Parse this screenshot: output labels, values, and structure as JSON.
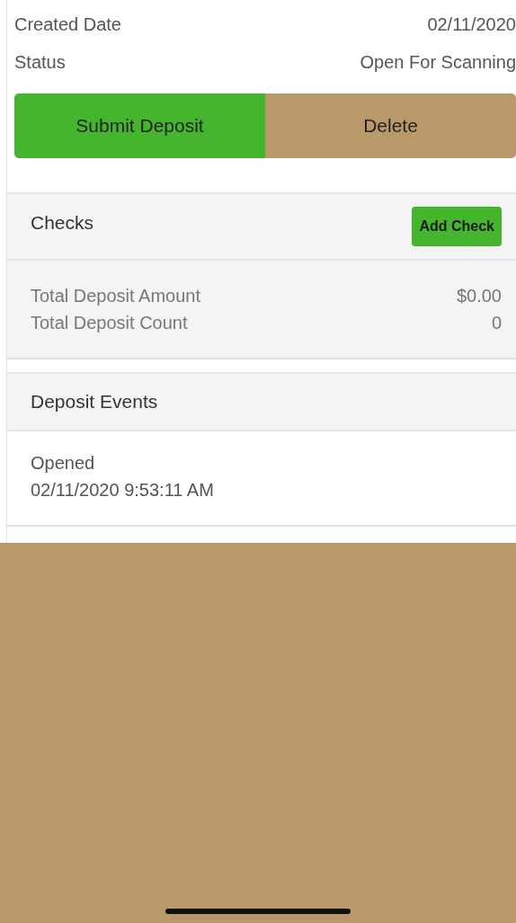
{
  "details": [
    {
      "label": "Created Date",
      "value": "02/11/2020"
    },
    {
      "label": "Status",
      "value": "Open For Scanning"
    }
  ],
  "actions": [
    {
      "label": "Submit Deposit",
      "kind": "primary"
    },
    {
      "label": "Delete",
      "kind": "secondary"
    }
  ],
  "checks": {
    "title": "Checks",
    "add_button": "Add Check",
    "totals": [
      {
        "label": "Total Deposit Amount",
        "value": "$0.00"
      },
      {
        "label": "Total Deposit Count",
        "value": "0"
      }
    ]
  },
  "events": {
    "title": "Deposit Events",
    "items": [
      {
        "name": "Opened",
        "time": "02/11/2020 9:53:11 AM"
      }
    ]
  }
}
